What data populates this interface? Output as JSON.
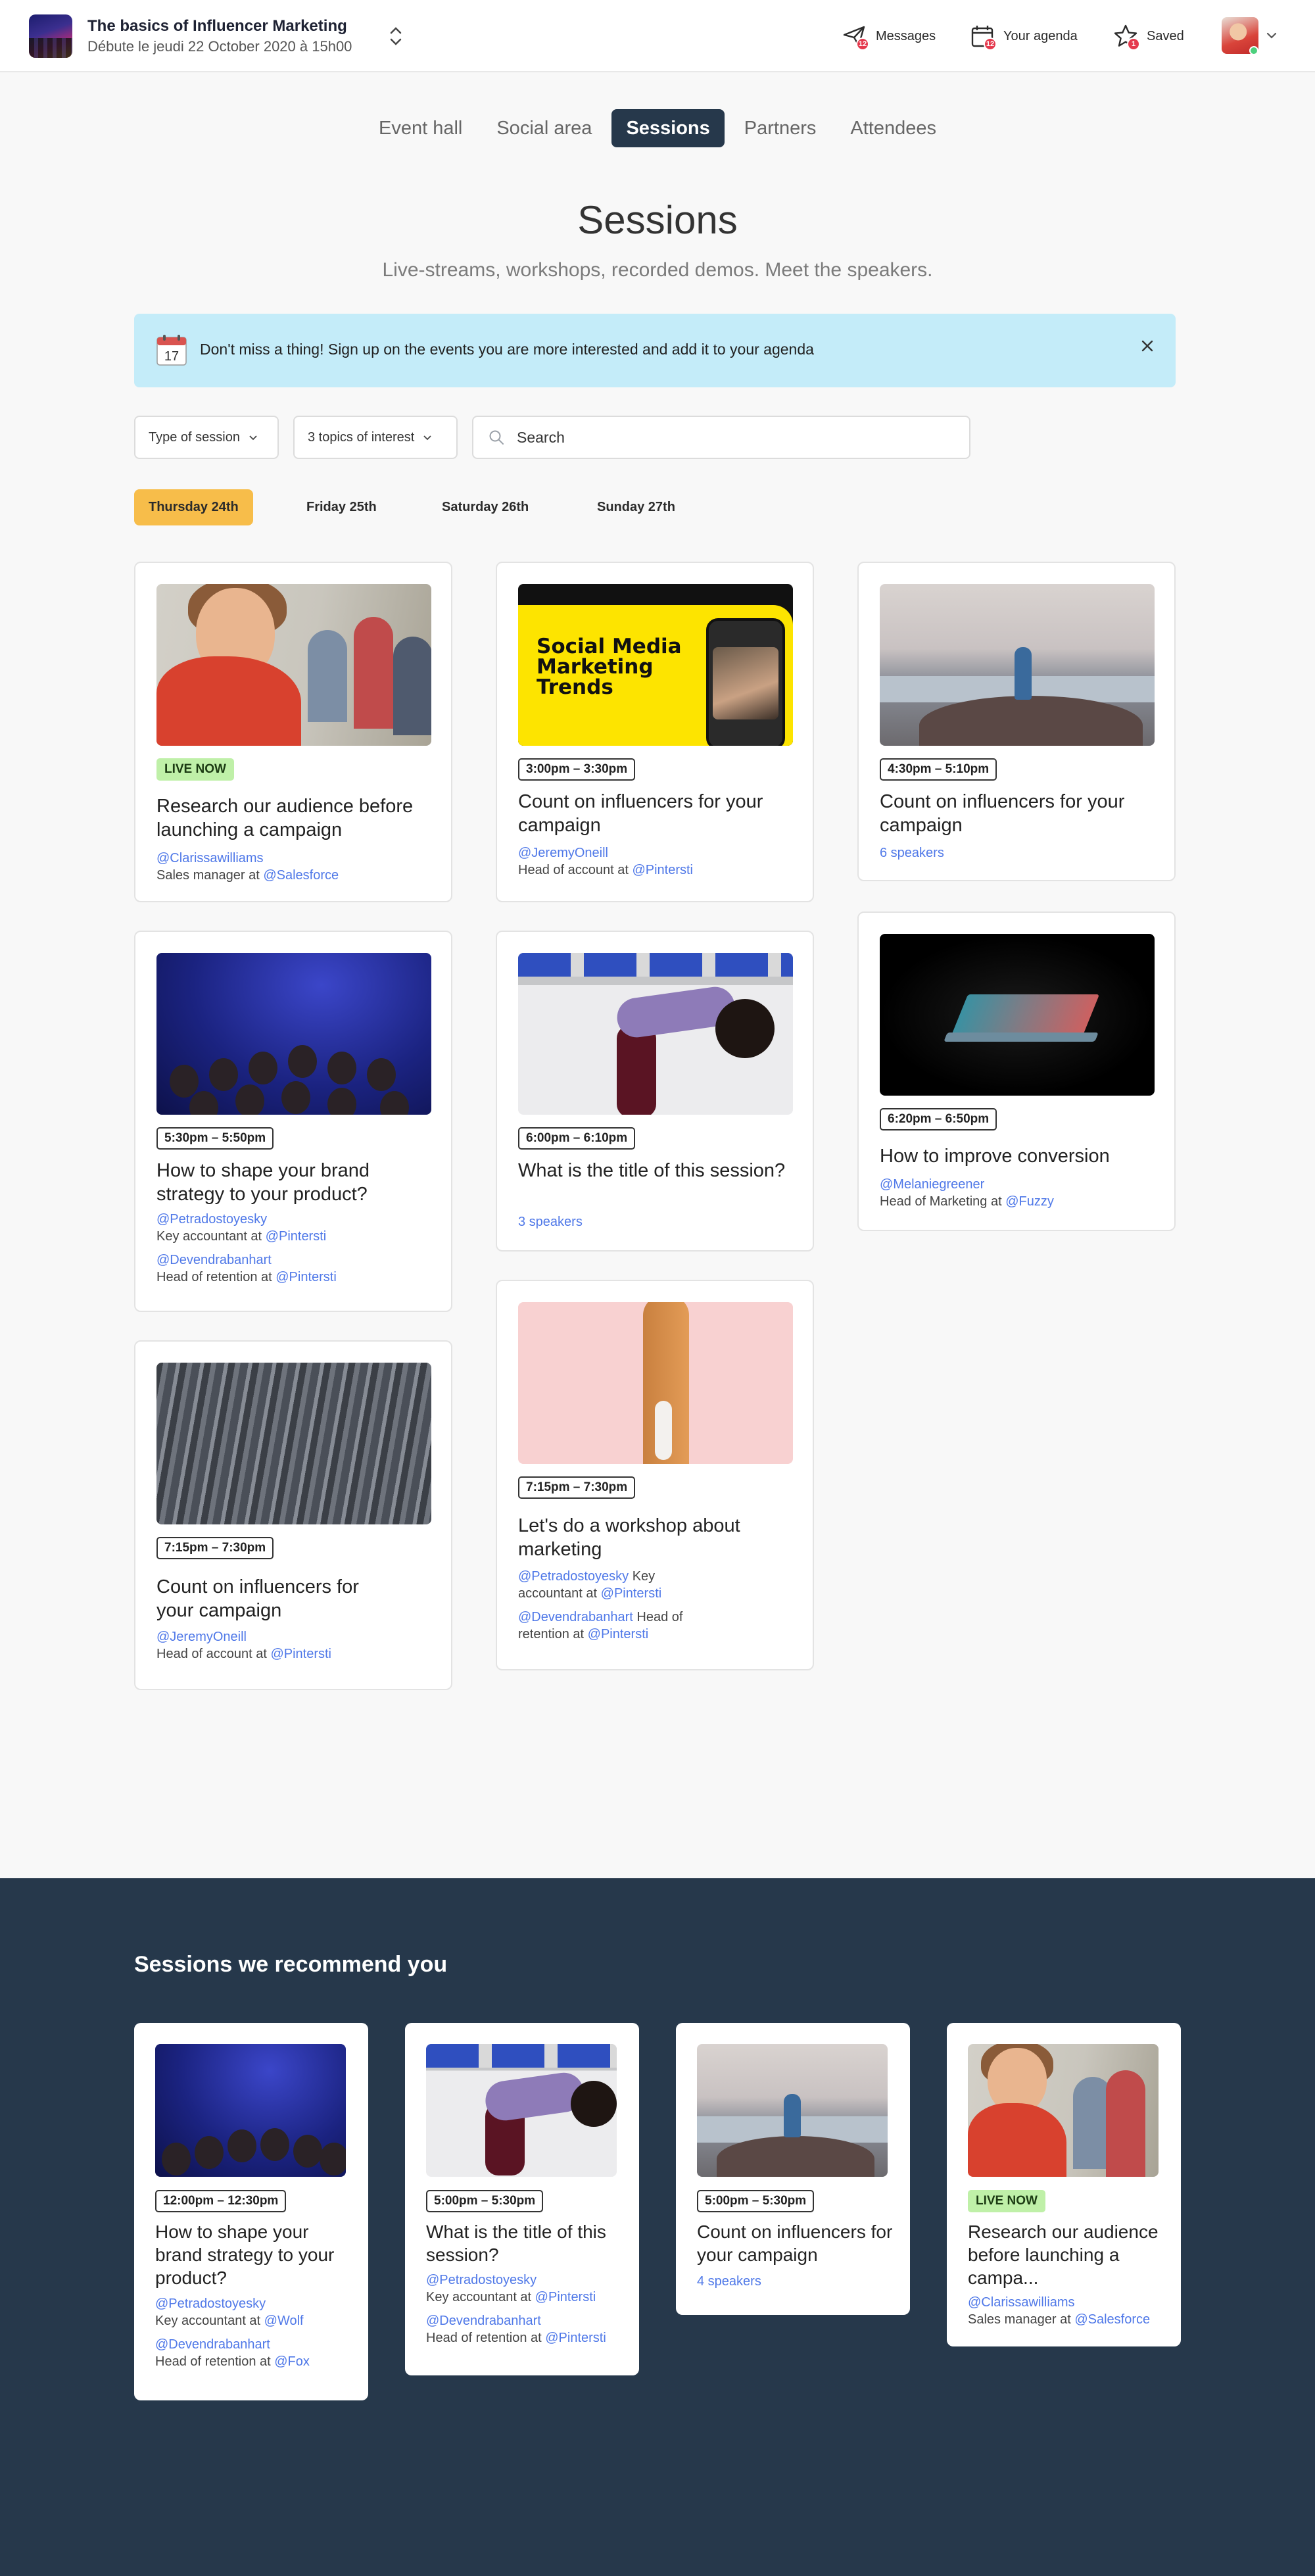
{
  "header": {
    "event_title": "The basics of Influencer Marketing",
    "event_date": "Débute le jeudi 22 October 2020 à 15h00",
    "nav": {
      "messages": {
        "label": "Messages",
        "badge": "12"
      },
      "agenda": {
        "label": "Your agenda",
        "badge": "12"
      },
      "saved": {
        "label": "Saved",
        "badge": "1"
      }
    }
  },
  "tabs": [
    "Event hall",
    "Social area",
    "Sessions",
    "Partners",
    "Attendees"
  ],
  "active_tab": "Sessions",
  "page": {
    "title": "Sessions",
    "subtitle": "Live-streams, workshops, recorded demos. Meet the speakers."
  },
  "banner": {
    "calendar_day": "17",
    "text": "Don't miss a thing! Sign up on the events you are more interested and add it to your agenda"
  },
  "filters": {
    "type": "Type of session",
    "topics": "3 topics of interest",
    "search_placeholder": "Search"
  },
  "days": [
    "Thursday 24th",
    "Friday 25th",
    "Saturday 26th",
    "Sunday 27th"
  ],
  "sessions": [
    {
      "badge": "LIVE NOW",
      "title": "Research our audience before launching a campaign",
      "speaker": "@Clarissawilliams",
      "role": "Sales manager at",
      "company": "@Salesforce"
    },
    {
      "time": "3:00pm – 3:30pm",
      "title": "Count on influencers for your campaign",
      "speaker": "@JeremyOneill",
      "role": "Head of account at",
      "company": "@Pintersti",
      "image_text": "Social Media Marketing Trends"
    },
    {
      "time": "4:30pm – 5:10pm",
      "title": "Count on influencers for your campaign",
      "speakers_count": "6 speakers"
    },
    {
      "time": "5:30pm – 5:50pm",
      "title": "How to shape your brand strategy to your product?",
      "speaker": "@Petradostoyesky",
      "role": "Key accountant at",
      "company": "@Pintersti",
      "speaker2": "@Devendrabanhart",
      "role2": "Head of retention at",
      "company2": "@Pintersti"
    },
    {
      "time": "6:00pm – 6:10pm",
      "title": "What is the title of this session?",
      "speakers_count": "3 speakers"
    },
    {
      "time": "6:20pm – 6:50pm",
      "title": "How to improve conversion",
      "speaker": "@Melaniegreener",
      "role": "Head of Marketing at",
      "company": "@Fuzzy"
    },
    {
      "time": "7:15pm – 7:30pm",
      "title": "Count on influencers for your campaign",
      "speaker": "@JeremyOneill",
      "role": "Head of account at",
      "company": "@Pintersti"
    },
    {
      "time": "7:15pm – 7:30pm",
      "title": "Let's do a workshop about marketing",
      "speaker": "@Petradostoyesky",
      "role": "Key accountant at",
      "company": "@Pintersti",
      "speaker2": "@Devendrabanhart",
      "role2": "Head of retention at",
      "company2": "@Pintersti"
    }
  ],
  "recommended": {
    "title": "Sessions we recommend you",
    "items": [
      {
        "time": "12:00pm – 12:30pm",
        "title": "How to shape your brand strategy to your product?",
        "speaker": "@Petradostoyesky",
        "role": "Key accountant at",
        "company": "@Wolf",
        "speaker2": "@Devendrabanhart",
        "role2": "Head of retention at",
        "company2": "@Fox"
      },
      {
        "time": "5:00pm – 5:30pm",
        "title": "What is the title of this session?",
        "speaker": "@Petradostoyesky",
        "role": "Key accountant at",
        "company": "@Pintersti",
        "speaker2": "@Devendrabanhart",
        "role2": "Head of retention at",
        "company2": "@Pintersti"
      },
      {
        "time": "5:00pm – 5:30pm",
        "title": "Count on influencers for your campaign",
        "speakers_count": "4 speakers"
      },
      {
        "badge": "LIVE NOW",
        "title": "Research our audience before launching a campa...",
        "speaker": "@Clarissawilliams",
        "role": "Sales manager at",
        "company": "@Salesforce"
      }
    ]
  },
  "colors": {
    "primary_dark": "#26384b",
    "accent_yellow": "#f7bd4a",
    "banner_blue": "#c4ecf9",
    "live_green": "#bff0a8",
    "link_blue": "#4f78e8",
    "badge_red": "#e5394d"
  }
}
